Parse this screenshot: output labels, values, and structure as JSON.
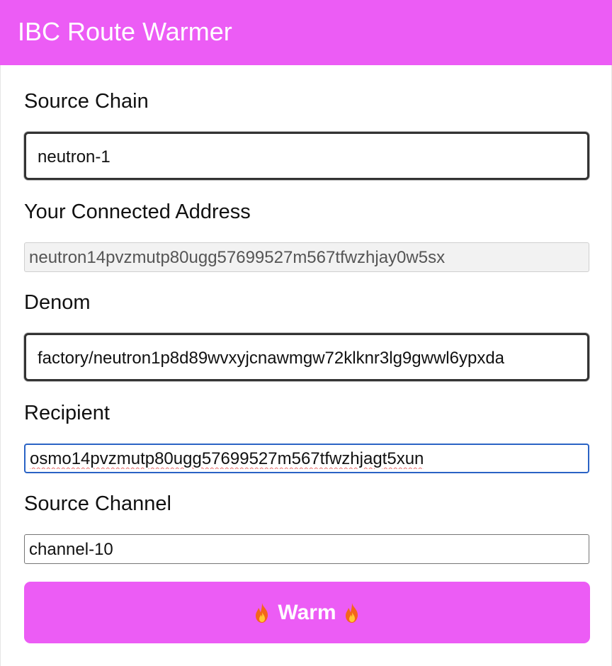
{
  "header": {
    "title": "IBC Route Warmer",
    "background_color": "#ec5cf5"
  },
  "form": {
    "source_chain": {
      "label": "Source Chain",
      "value": "neutron-1"
    },
    "connected_address": {
      "label": "Your Connected Address",
      "value": "neutron14pvzmutp80ugg57699527m567tfwzhjay0w5sx",
      "disabled": true
    },
    "denom": {
      "label": "Denom",
      "value": "factory/neutron1p8d89wvxyjcnawmgw72klknr3lg9gwwl6ypxda"
    },
    "recipient": {
      "label": "Recipient",
      "value": "osmo14pvzmutp80ugg57699527m567tfwzhjagt5xun",
      "focused": true
    },
    "source_channel": {
      "label": "Source Channel",
      "value": "channel-10"
    }
  },
  "warm_button": {
    "label": "Warm",
    "icon": "fire-icon",
    "background_color": "#ec5cf5"
  }
}
